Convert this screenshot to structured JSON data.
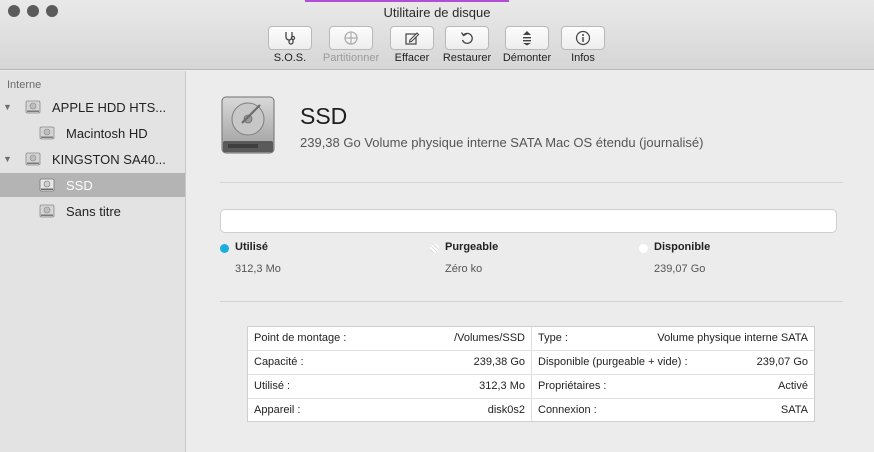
{
  "window": {
    "title": "Utilitaire de disque"
  },
  "toolbar": {
    "buttons": [
      {
        "label": "S.O.S.",
        "icon": "stethoscope-icon",
        "enabled": true
      },
      {
        "label": "Partitionner",
        "icon": "partition-icon",
        "enabled": false
      },
      {
        "label": "Effacer",
        "icon": "erase-icon",
        "enabled": true
      },
      {
        "label": "Restaurer",
        "icon": "restore-icon",
        "enabled": true
      },
      {
        "label": "Démonter",
        "icon": "unmount-icon",
        "enabled": true
      },
      {
        "label": "Infos",
        "icon": "info-icon",
        "enabled": true
      }
    ]
  },
  "sidebar": {
    "section_label": "Interne",
    "items": [
      {
        "label": "APPLE HDD HTS...",
        "kind": "disk",
        "expanded": true,
        "selected": false
      },
      {
        "label": "Macintosh HD",
        "kind": "volume",
        "selected": false
      },
      {
        "label": "KINGSTON SA40...",
        "kind": "disk",
        "expanded": true,
        "selected": false
      },
      {
        "label": "SSD",
        "kind": "volume",
        "selected": true
      },
      {
        "label": "Sans titre",
        "kind": "volume",
        "selected": false
      }
    ]
  },
  "volume": {
    "name": "SSD",
    "description": "239,38 Go Volume physique interne SATA Mac OS étendu (journalisé)"
  },
  "usage": {
    "legend": [
      {
        "label": "Utilisé",
        "value": "312,3 Mo",
        "color": "#1aaee0"
      },
      {
        "label": "Purgeable",
        "value": "Zéro ko",
        "color": "#ffffff"
      },
      {
        "label": "Disponible",
        "value": "239,07 Go",
        "color": "#ffffff"
      }
    ]
  },
  "info": {
    "left": [
      {
        "label": "Point de montage :",
        "value": "/Volumes/SSD"
      },
      {
        "label": "Capacité :",
        "value": "239,38 Go"
      },
      {
        "label": "Utilisé :",
        "value": "312,3 Mo"
      },
      {
        "label": "Appareil :",
        "value": "disk0s2"
      }
    ],
    "right": [
      {
        "label": "Type :",
        "value": "Volume physique interne SATA"
      },
      {
        "label": "Disponible (purgeable + vide) :",
        "value": "239,07 Go"
      },
      {
        "label": "Propriétaires :",
        "value": "Activé"
      },
      {
        "label": "Connexion :",
        "value": "SATA"
      }
    ]
  }
}
